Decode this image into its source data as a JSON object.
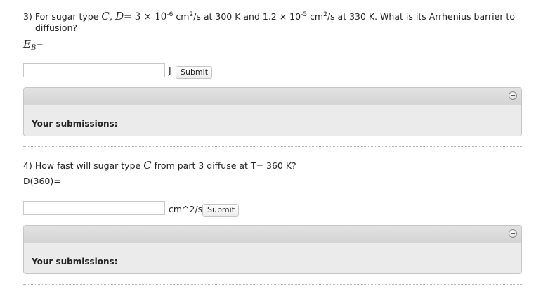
{
  "q3": {
    "number": "3)",
    "text_for": "For sugar type",
    "var_c": "C,",
    "var_d": "D",
    "eq": "= 3 × 10",
    "exp1": "-6",
    "unit1_base": "cm",
    "unit1_sup": "2",
    "unit1_rest": "/s at 300 K and  1.2 × 10",
    "exp2": "-5",
    "unit2_base": "cm",
    "unit2_sup": "2",
    "text_tail": "/s at 330 K. What is its Arrhenius barrier to",
    "text_line2": "diffusion?",
    "answer_label_var": "E",
    "answer_label_sub": "B",
    "answer_label_eq": "=",
    "input_value": "",
    "unit": "J",
    "submit_label": "Submit",
    "submissions_label": "Your submissions:"
  },
  "q4": {
    "number": "4)",
    "text_pre": "How fast will sugar type",
    "var_c": "C",
    "text_post": "from part 3 diffuse at T= 360 K?",
    "answer_label": "D(360)=",
    "input_value": "",
    "unit": "cm^2/s",
    "submit_label": "Submit",
    "submissions_label": "Your submissions:"
  }
}
